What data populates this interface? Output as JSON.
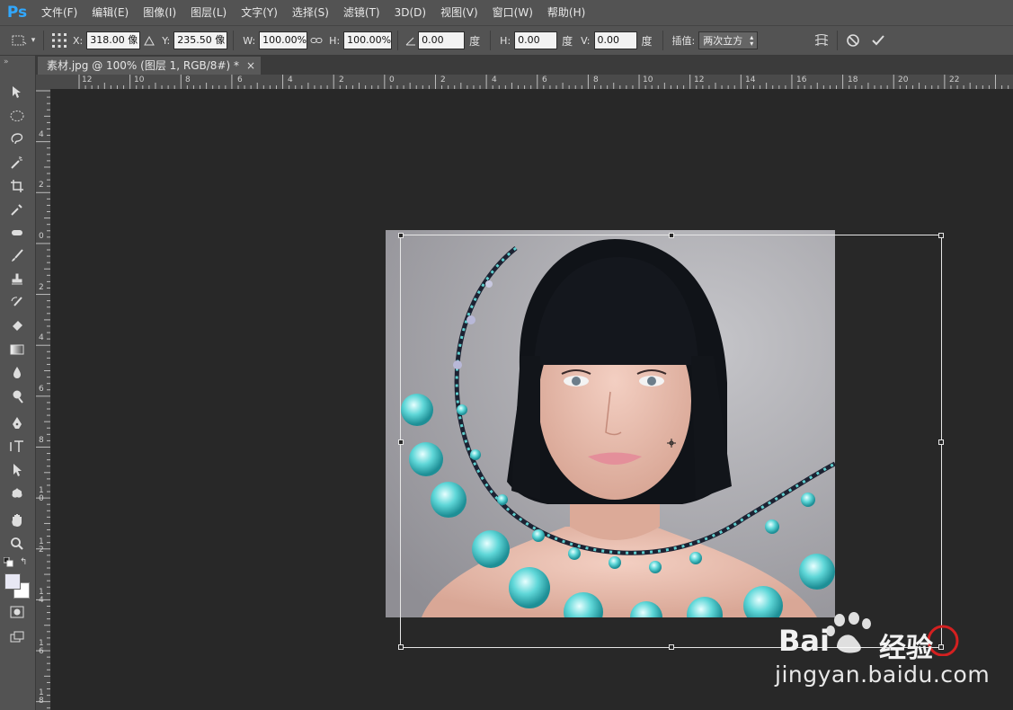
{
  "app": {
    "logo": "Ps"
  },
  "menu": [
    "文件(F)",
    "编辑(E)",
    "图像(I)",
    "图层(L)",
    "文字(Y)",
    "选择(S)",
    "滤镜(T)",
    "3D(D)",
    "视图(V)",
    "窗口(W)",
    "帮助(H)"
  ],
  "options": {
    "x_label": "X:",
    "x_value": "318.00 像",
    "y_label": "Y:",
    "y_value": "235.50 像",
    "w_label": "W:",
    "w_value": "100.00%",
    "h_label": "H:",
    "h_value": "100.00%",
    "angle_value": "0.00",
    "angle_unit": "度",
    "hskew_label": "H:",
    "hskew_value": "0.00",
    "hskew_unit": "度",
    "vskew_label": "V:",
    "vskew_value": "0.00",
    "vskew_unit": "度",
    "interp_label": "插值:",
    "interp_value": "两次立方"
  },
  "document": {
    "tab_title": "素材.jpg @ 100% (图层 1, RGB/8#) *",
    "close_glyph": "×"
  },
  "ruler_h": [
    "12",
    "10",
    "8",
    "6",
    "4",
    "2",
    "0",
    "2",
    "4",
    "6",
    "8",
    "10",
    "12",
    "14",
    "16",
    "18",
    "20",
    "22"
  ],
  "ruler_v": [
    "4",
    "2",
    "0",
    "2",
    "4",
    "6",
    "8",
    "10",
    "12",
    "14",
    "16",
    "18"
  ],
  "watermark": {
    "logo_text": "Bai",
    "logo_cn": "经验",
    "url": "jingyan.baidu.com"
  },
  "colors": {
    "ps_blue": "#31a8ff",
    "panel": "#535353",
    "canvas": "#282828"
  },
  "icons": [
    "reference-point-icon",
    "link-icon",
    "angle-icon",
    "warp-icon",
    "cancel-icon",
    "commit-icon"
  ]
}
